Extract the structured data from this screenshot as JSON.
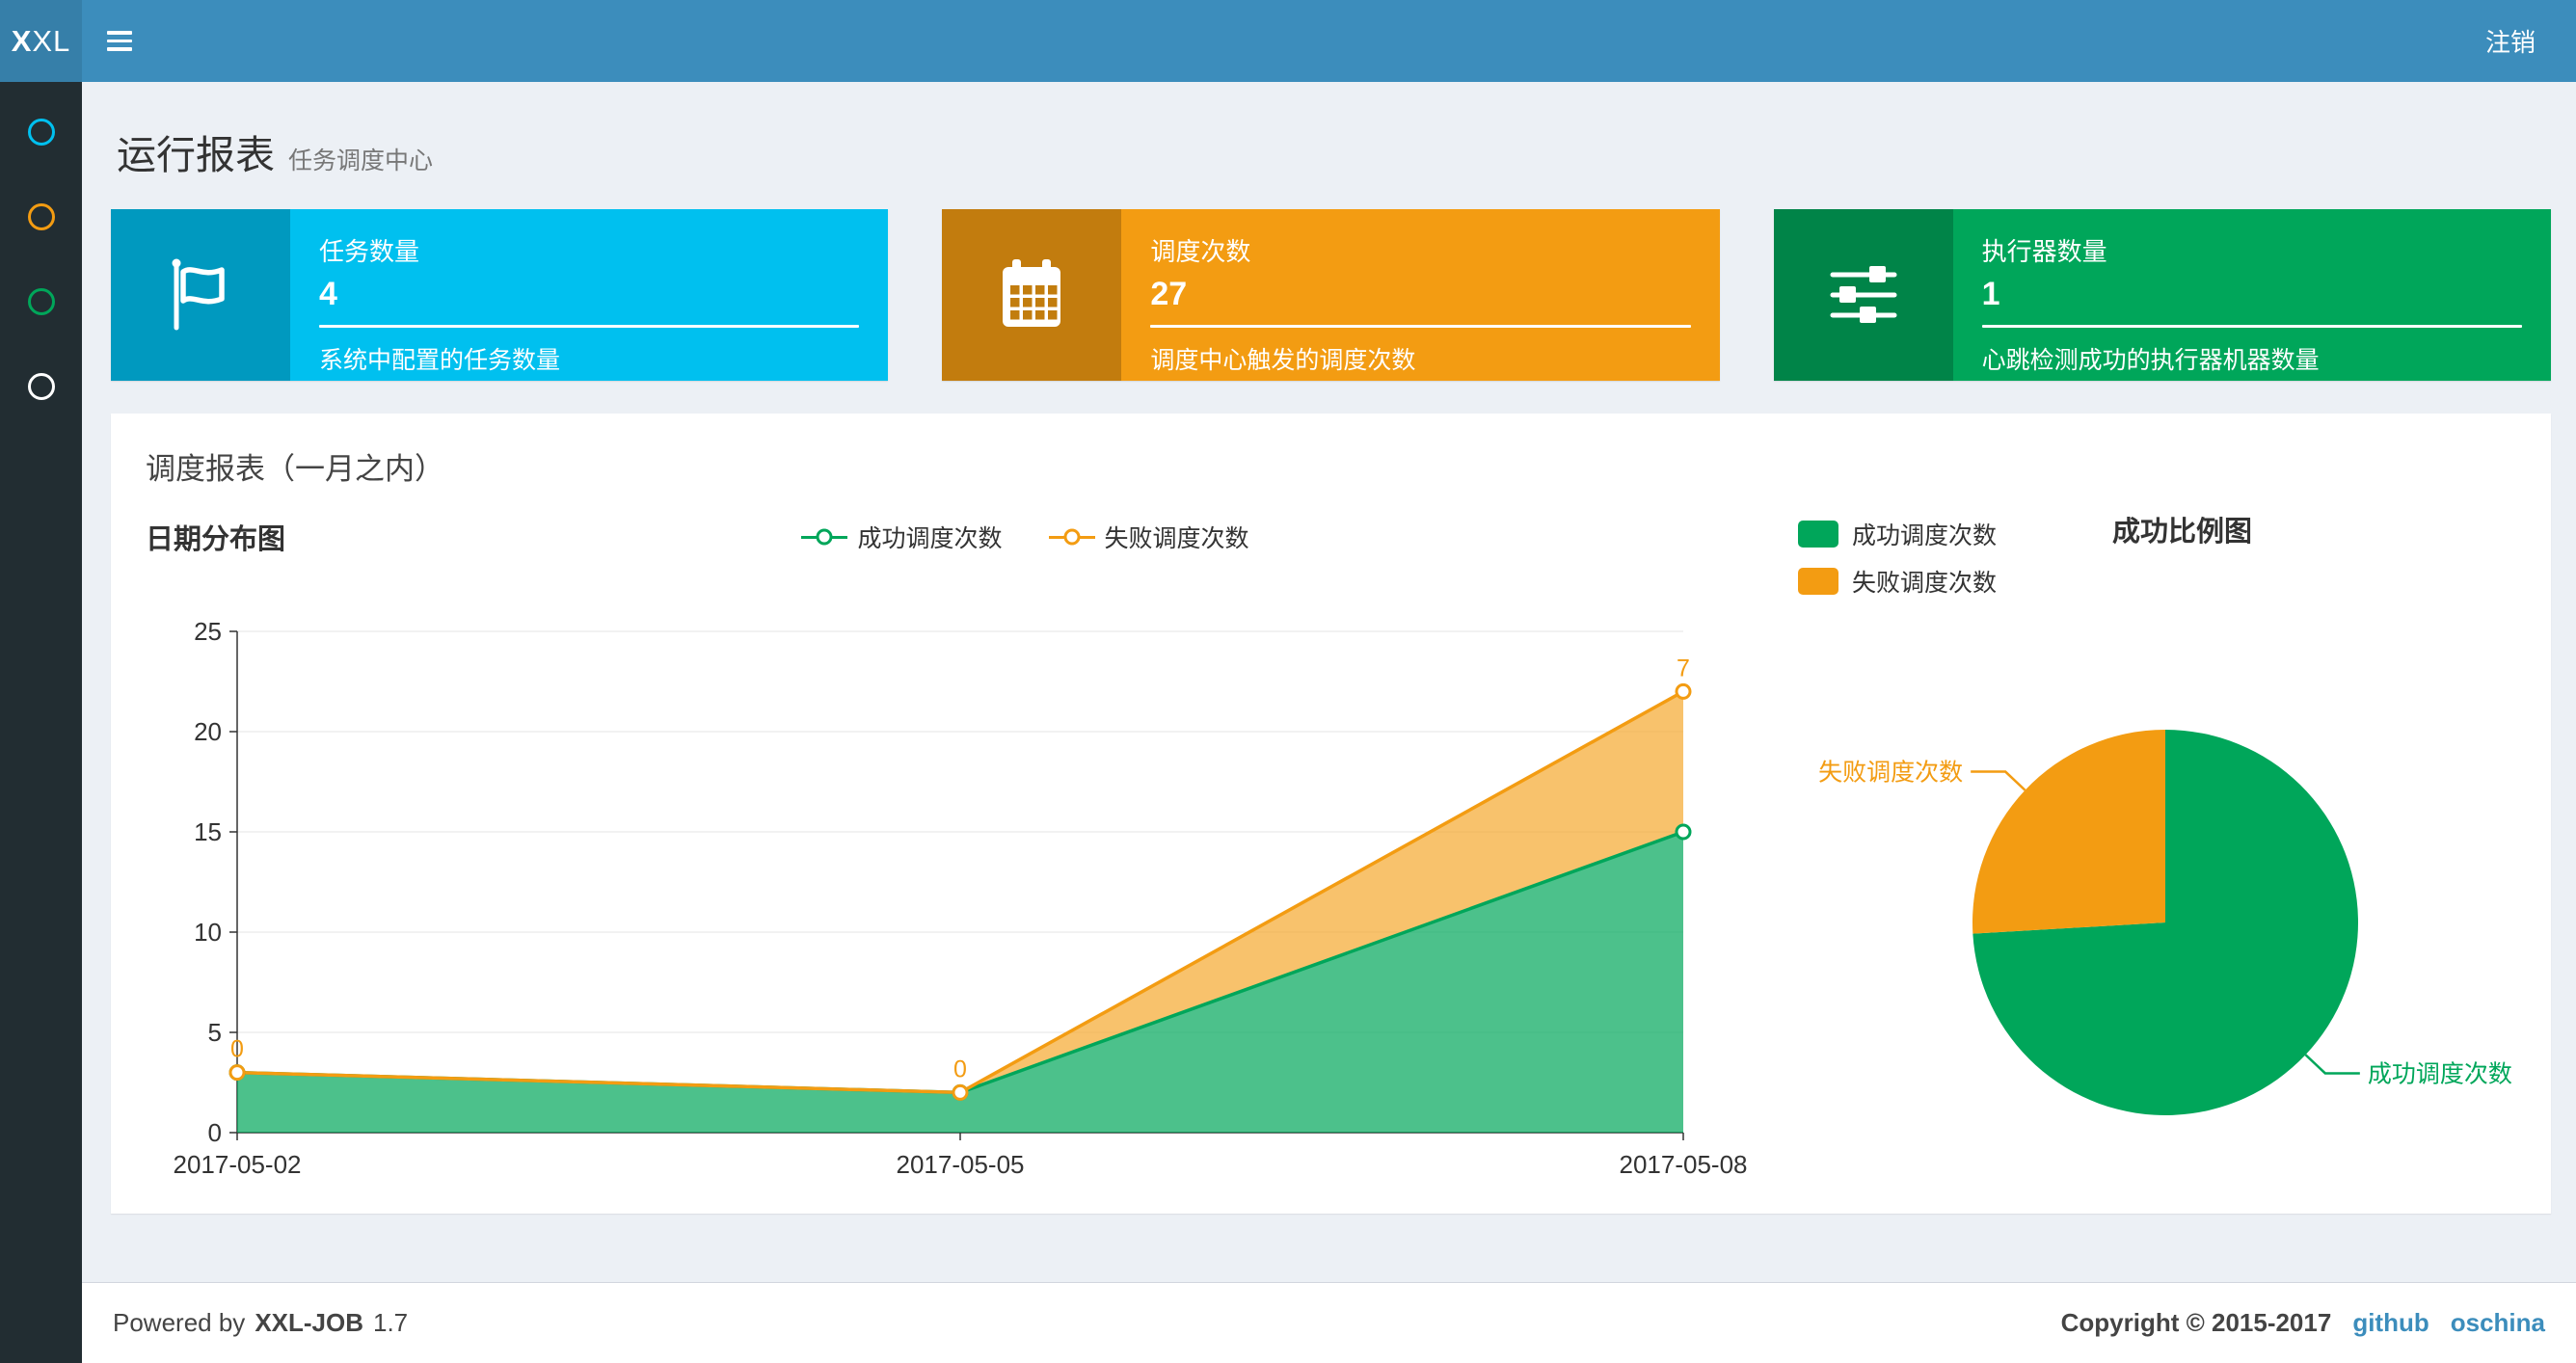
{
  "theme": {
    "navbar_bg": "#3c8dbc",
    "logo_bg": "#367fa9",
    "sidebar_bg": "#222d32",
    "content_bg": "#ecf0f5",
    "link_color": "#3c8dbc"
  },
  "navbar": {
    "logo_bold": "X",
    "logo_rest": "XL",
    "logout_label": "注销"
  },
  "sidebar": {
    "items": [
      {
        "icon": "circle-icon",
        "color": "#00c0ef"
      },
      {
        "icon": "circle-icon",
        "color": "#f39c12"
      },
      {
        "icon": "circle-icon",
        "color": "#00a65a"
      },
      {
        "icon": "circle-icon",
        "color": "#ffffff"
      }
    ]
  },
  "page_header": {
    "title": "运行报表",
    "subtitle": "任务调度中心"
  },
  "info_boxes": [
    {
      "icon": "flag-icon",
      "title": "任务数量",
      "value": "4",
      "desc": "系统中配置的任务数量",
      "color": "#00c0ef"
    },
    {
      "icon": "calendar-icon",
      "title": "调度次数",
      "value": "27",
      "desc": "调度中心触发的调度次数",
      "color": "#f39c12"
    },
    {
      "icon": "sliders-icon",
      "title": "执行器数量",
      "value": "1",
      "desc": "心跳检测成功的执行器机器数量",
      "color": "#00a65a"
    }
  ],
  "panel": {
    "title": "调度报表（一月之内）"
  },
  "chart_data": [
    {
      "type": "area",
      "title": "日期分布图",
      "x": [
        "2017-05-02",
        "2017-05-05",
        "2017-05-08"
      ],
      "series": [
        {
          "name": "成功调度次数",
          "color": "#00A65A",
          "values": [
            3,
            2,
            15
          ]
        },
        {
          "name": "失败调度次数",
          "color": "#F39C12",
          "values": [
            0,
            0,
            7
          ]
        }
      ],
      "stacked": true,
      "point_labels_series": 1,
      "ylim": [
        0,
        25
      ],
      "yticks": [
        0,
        5,
        10,
        15,
        20,
        25
      ],
      "grid": true,
      "legend_position": "top-center"
    },
    {
      "type": "pie",
      "title": "成功比例图",
      "slices": [
        {
          "name": "成功调度次数",
          "value": 20,
          "color": "#00A65A"
        },
        {
          "name": "失败调度次数",
          "value": 7,
          "color": "#F39C12"
        }
      ],
      "legend_position": "top-left"
    }
  ],
  "footer": {
    "powered_prefix": "Powered by",
    "product": "XXL-JOB",
    "version": "1.7",
    "copyright": "Copyright © 2015-2017",
    "links": [
      {
        "label": "github"
      },
      {
        "label": "oschina"
      }
    ]
  }
}
